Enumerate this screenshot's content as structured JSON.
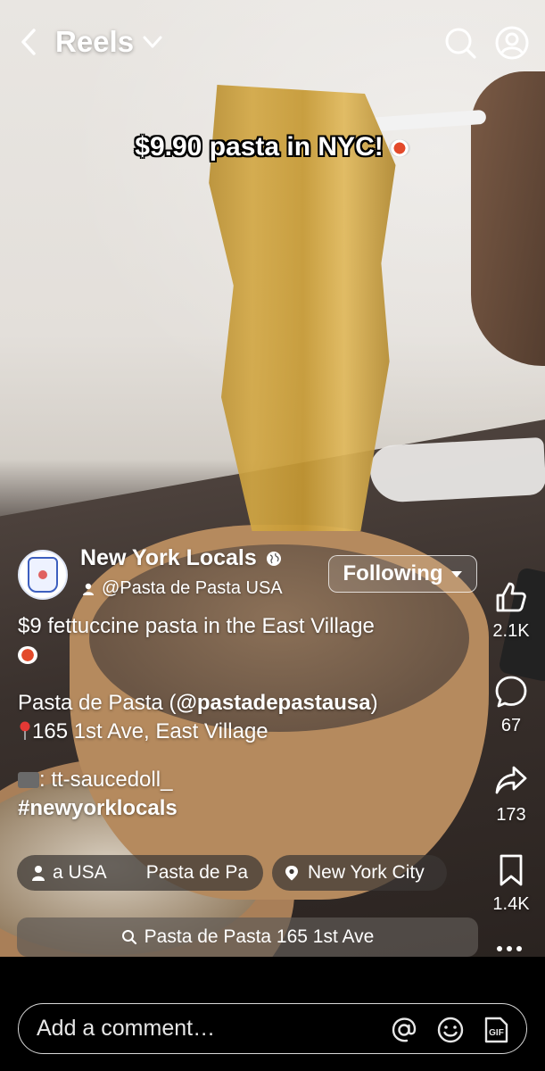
{
  "header": {
    "title": "Reels"
  },
  "video": {
    "caption_overlay": "$9.90 pasta in NYC!"
  },
  "author": {
    "name": "New York Locals",
    "collab": "@Pasta de Pasta USA",
    "follow_label": "Following"
  },
  "description": {
    "line1": "$9 fettuccine pasta in the East Village",
    "line2_prefix": "Pasta de Pasta (",
    "line2_handle": "@pastadepastausa",
    "line2_suffix": ")",
    "line3": "165 1st Ave, East Village",
    "line4": ": tt-saucedoll_",
    "hashtag": "#newyorklocals"
  },
  "chips": {
    "collab_chip_a": "a USA",
    "collab_chip_b": "Pasta de Pa",
    "location": "New York City"
  },
  "search_suggestion": "Pasta de Pasta 165 1st Ave",
  "actions": {
    "likes": "2.1K",
    "comments": "67",
    "shares": "173",
    "saves": "1.4K"
  },
  "comment": {
    "placeholder": "Add a comment…"
  },
  "icons": [
    "back-icon",
    "chevron-down-icon",
    "search-icon",
    "profile-icon",
    "globe-icon",
    "person-icon",
    "like-icon",
    "comment-icon",
    "share-icon",
    "save-icon",
    "more-icon",
    "location-pin-icon",
    "mention-icon",
    "emoji-icon",
    "gif-icon"
  ]
}
